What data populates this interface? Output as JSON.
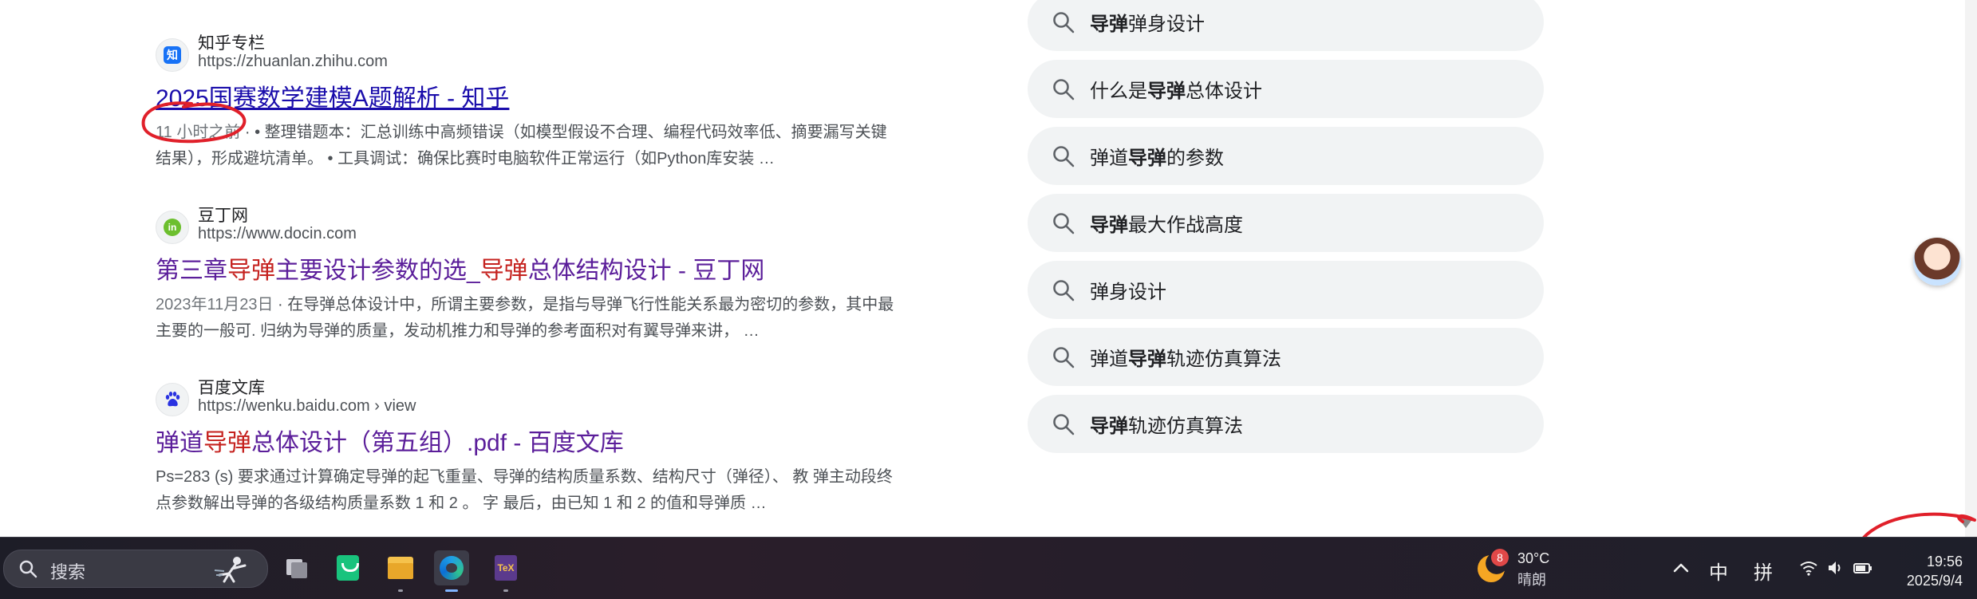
{
  "results": [
    {
      "site_name": "知乎专栏",
      "url": "https://zhuanlan.zhihu.com",
      "icon": "zhihu-icon",
      "title_parts": [
        {
          "t": "2025国赛数学建模A题解析 - 知乎",
          "h": false
        }
      ],
      "snippet_date": "11 小时之前",
      "snippet": " · • 整理错题本：汇总训练中高频错误（如模型假设不合理、编程代码效率低、摘要漏写关键结果），形成避坑清单。 • 工具调试：确保比赛时电脑软件正常运行（如Python库安装 …"
    },
    {
      "site_name": "豆丁网",
      "url": "https://www.docin.com",
      "icon": "docin-icon",
      "title_parts": [
        {
          "t": "第三章",
          "h": false
        },
        {
          "t": "导弹",
          "h": true
        },
        {
          "t": "主要设计参数的选_",
          "h": false
        },
        {
          "t": "导弹",
          "h": true
        },
        {
          "t": "总体结构设计 - 豆丁网",
          "h": false
        }
      ],
      "snippet_date": "2023年11月23日",
      "snippet": " · 在导弹总体设计中，所谓主要参数，是指与导弹飞行性能关系最为密切的参数，其中最主要的一般可. 归纳为导弹的质量，发动机推力和导弹的参考面积对有翼导弹来讲， …"
    },
    {
      "site_name": "百度文库",
      "url": "https://wenku.baidu.com › view",
      "icon": "baidu-paw-icon",
      "title_parts": [
        {
          "t": "弹道",
          "h": false
        },
        {
          "t": "导弹",
          "h": true
        },
        {
          "t": "总体设计（第五组）.pdf - 百度文库",
          "h": false
        }
      ],
      "snippet_date": "",
      "snippet": "Ps=283 (s) 要求通过计算确定导弹的起飞重量、导弹的结构质量系数、结构尺寸（弹径）、 教 弹主动段终点参数解出导弹的各级结构质量系数 1 和 2 。 字 最后，由已知 1 和 2 的值和导弹质 …"
    }
  ],
  "related_searches": [
    [
      {
        "t": "导弹",
        "b": true
      },
      {
        "t": "弹身设计",
        "b": false
      }
    ],
    [
      {
        "t": "什么是",
        "b": false
      },
      {
        "t": "导弹",
        "b": true
      },
      {
        "t": "总体设计",
        "b": false
      }
    ],
    [
      {
        "t": "弹道",
        "b": false
      },
      {
        "t": "导弹",
        "b": true
      },
      {
        "t": "的参数",
        "b": false
      }
    ],
    [
      {
        "t": "导弹",
        "b": true
      },
      {
        "t": "最大作战高度",
        "b": false
      }
    ],
    [
      {
        "t": "弹身设计",
        "b": false
      }
    ],
    [
      {
        "t": "弹道",
        "b": false
      },
      {
        "t": "导弹",
        "b": true
      },
      {
        "t": "轨迹仿真算法",
        "b": false
      }
    ],
    [
      {
        "t": "导弹",
        "b": true
      },
      {
        "t": "轨迹仿真算法",
        "b": false
      }
    ]
  ],
  "taskbar": {
    "search_placeholder": "搜索",
    "apps": [
      "task-view-icon",
      "wechat-like-icon",
      "file-explorer-icon",
      "edge-browser-icon",
      "texstudio-icon"
    ],
    "weather": {
      "badge": "8",
      "temp": "30°C",
      "condition": "晴朗"
    },
    "ime_lang": "中",
    "ime_mode": "拼",
    "time": "19:56",
    "date": "2025/9/4"
  },
  "colors": {
    "link": "#1a0dab",
    "visited": "#5b1e9a",
    "highlight": "#c5221f",
    "annotation": "#e0202a"
  }
}
